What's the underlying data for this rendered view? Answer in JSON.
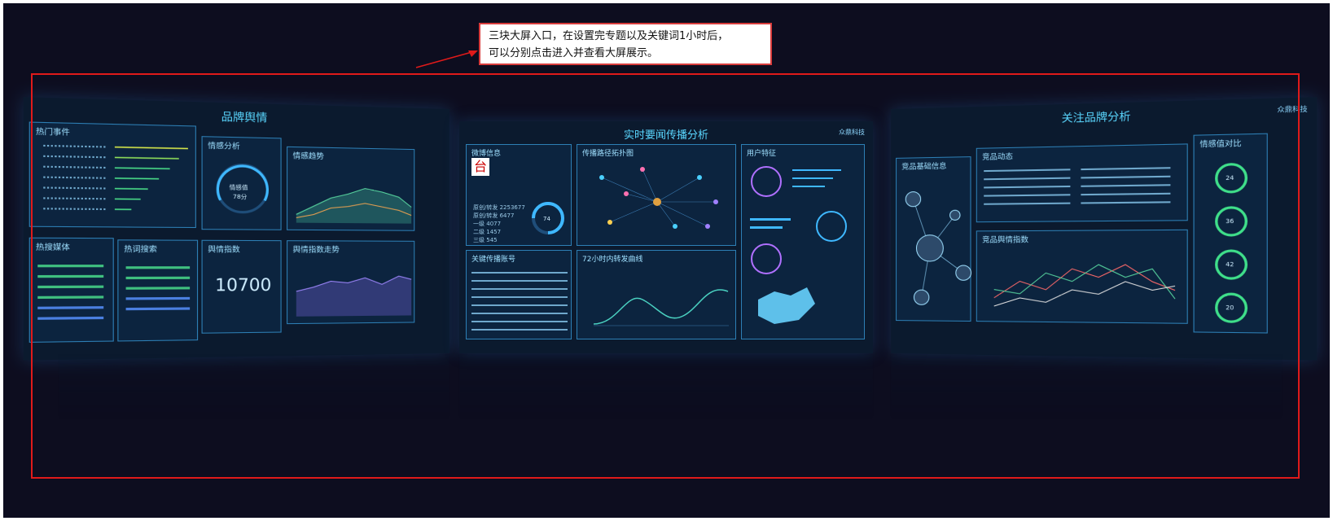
{
  "annotation": {
    "line1": "三块大屏入口，在设置完专题以及关键词1小时后，",
    "line2": "可以分别点击进入并查看大屏展示。",
    "border_color": "#e01a1a"
  },
  "screens": {
    "left": {
      "title": "品牌舆情",
      "panels": {
        "hot_events": "热门事件",
        "sentiment": "情感分析",
        "sentiment_trend": "情感趋势",
        "hot_media": "热搜媒体",
        "hot_search": "热词搜索",
        "public_index": "舆情指数",
        "index_trend": "舆情指数走势"
      },
      "sentiment_label": "情感值",
      "sentiment_value": "78分",
      "public_index_value": "10700"
    },
    "middle": {
      "title": "实时要闻传播分析",
      "logo": "众鼎科技",
      "panels": {
        "weibo_info": "微博信息",
        "propagation_topology": "传播路径拓扑图",
        "user_features": "用户特征",
        "key_accounts": "关键传播账号",
        "forward_curve": "72小时内转发曲线"
      },
      "weibo_badge": "台",
      "weibo_stats": [
        {
          "label": "原创/转发",
          "value": "2253677"
        },
        {
          "label": "原创/转发",
          "value": "6477"
        },
        {
          "label": "一级",
          "value": "4077"
        },
        {
          "label": "二级",
          "value": "1457"
        },
        {
          "label": "三级",
          "value": "545"
        }
      ],
      "user_index_value": "74"
    },
    "right": {
      "title": "关注品牌分析",
      "logo": "众鼎科技",
      "panels": {
        "brand_info": "竞品基础信息",
        "brand_news": "竞品动态",
        "compare": "情感值对比",
        "brand_trend": "竞品舆情指数"
      },
      "compare_values": [
        "24",
        "36",
        "42",
        "20"
      ]
    }
  }
}
